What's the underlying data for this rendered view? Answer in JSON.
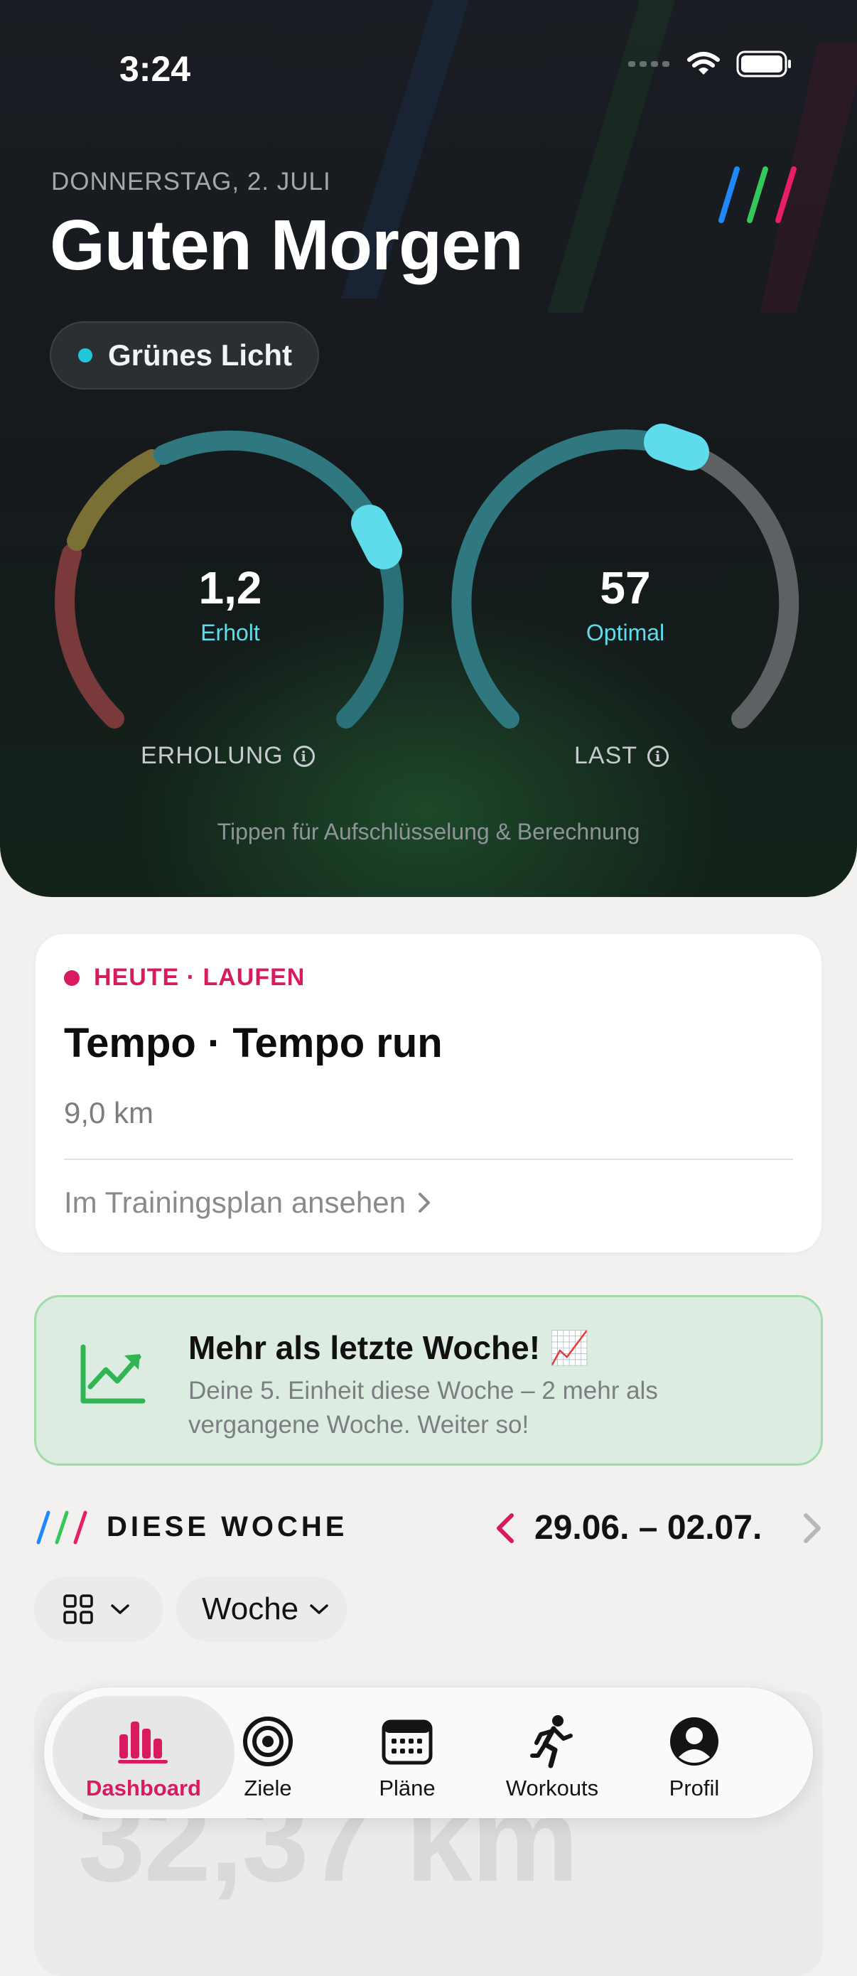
{
  "status_bar": {
    "time": "3:24"
  },
  "hero": {
    "date": "DONNERSTAG, 2. JULI",
    "greeting": "Guten Morgen",
    "status_pill": "Grünes Licht",
    "gauges": [
      {
        "value": "1,2",
        "status": "Erholt",
        "caption": "ERHOLUNG"
      },
      {
        "value": "57",
        "status": "Optimal",
        "caption": "LAST"
      }
    ],
    "hint": "Tippen für Aufschlüsselung & Berechnung"
  },
  "today_card": {
    "tag": "HEUTE · LAUFEN",
    "title": "Tempo · Tempo run",
    "distance": "9,0 km",
    "link": "Im Trainingsplan ansehen"
  },
  "banner": {
    "title": "Mehr als letzte Woche! 📈",
    "text": "Deine 5. Einheit diese Woche – 2 mehr als vergangene Woche. Weiter so!"
  },
  "week": {
    "title": "DIESE WOCHE",
    "range": "29.06. – 02.07.",
    "period_select": "Woche",
    "big_stat": "32,37 km"
  },
  "tabs": [
    {
      "label": "Dashboard",
      "icon": "bar-chart-icon",
      "active": true
    },
    {
      "label": "Ziele",
      "icon": "target-icon"
    },
    {
      "label": "Pläne",
      "icon": "calendar-icon"
    },
    {
      "label": "Workouts",
      "icon": "runner-icon"
    },
    {
      "label": "Profil",
      "icon": "profile-icon"
    }
  ],
  "colors": {
    "accent": "#d81b60",
    "cyan": "#5fdcec",
    "green_banner": "#dcece0"
  }
}
